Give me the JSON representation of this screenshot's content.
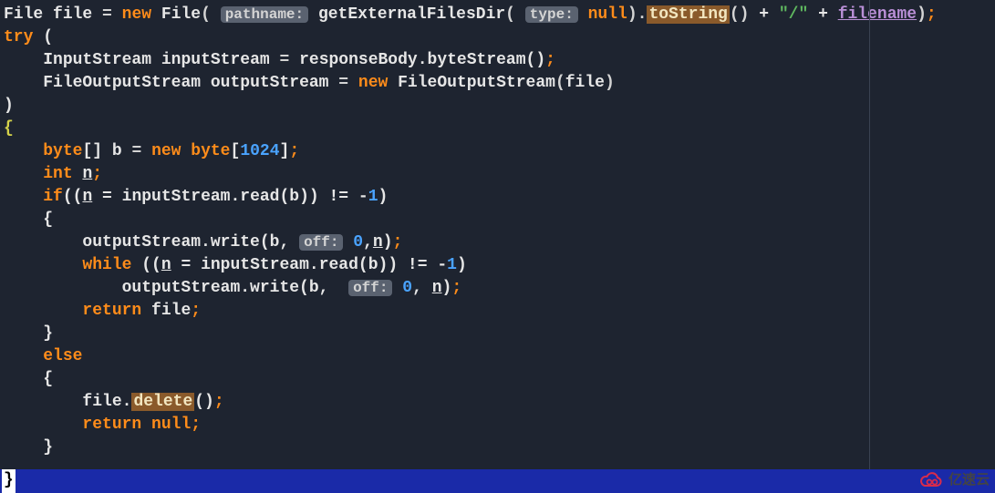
{
  "code": {
    "l1": {
      "typeFile": "File",
      "varFile": "file",
      "eq": " = ",
      "new": "new",
      "FileCtor": "File",
      "hintPath": "pathname:",
      "getExt": "getExternalFilesDir",
      "hintType": "type:",
      "nullKw": "null",
      "toString": "toString",
      "slash": "\"/\"",
      "plus": " + ",
      "filename": "filename"
    },
    "l2": {
      "try": "try"
    },
    "l3": {
      "inputStreamType": "InputStream",
      "isVar": "inputStream",
      "body": "responseBody.byteStream()"
    },
    "l4": {
      "fosType": "FileOutputStream",
      "osVar": "outputStream",
      "new": "new",
      "fosCtor": "FileOutputStream",
      "arg": "file"
    },
    "l7": {
      "byte": "byte",
      "b": "b",
      "new": "new",
      "byte2": "byte",
      "num": "1024"
    },
    "l8": {
      "int": "int",
      "n": "n"
    },
    "l9": {
      "if": "if",
      "n": "n",
      "read": "inputStream.read(b)",
      "neg1": "1"
    },
    "l11": {
      "call": "outputStream.write(b,",
      "off": "off:",
      "zero": "0",
      "n": "n"
    },
    "l12": {
      "while": "while",
      "n": "n",
      "read": "inputStream.read(b)",
      "neg1": "1"
    },
    "l13": {
      "call": "outputStream.write(b, ",
      "off": "off:",
      "zero": "0",
      "n": "n"
    },
    "l14": {
      "return": "return",
      "file": "file"
    },
    "l16": {
      "else": "else"
    },
    "l18": {
      "file": "file.",
      "delete": "delete"
    },
    "l19": {
      "return": "return",
      "null": "null"
    }
  },
  "ui": {
    "bottom_brace": "}",
    "logo_text": "亿速云"
  }
}
